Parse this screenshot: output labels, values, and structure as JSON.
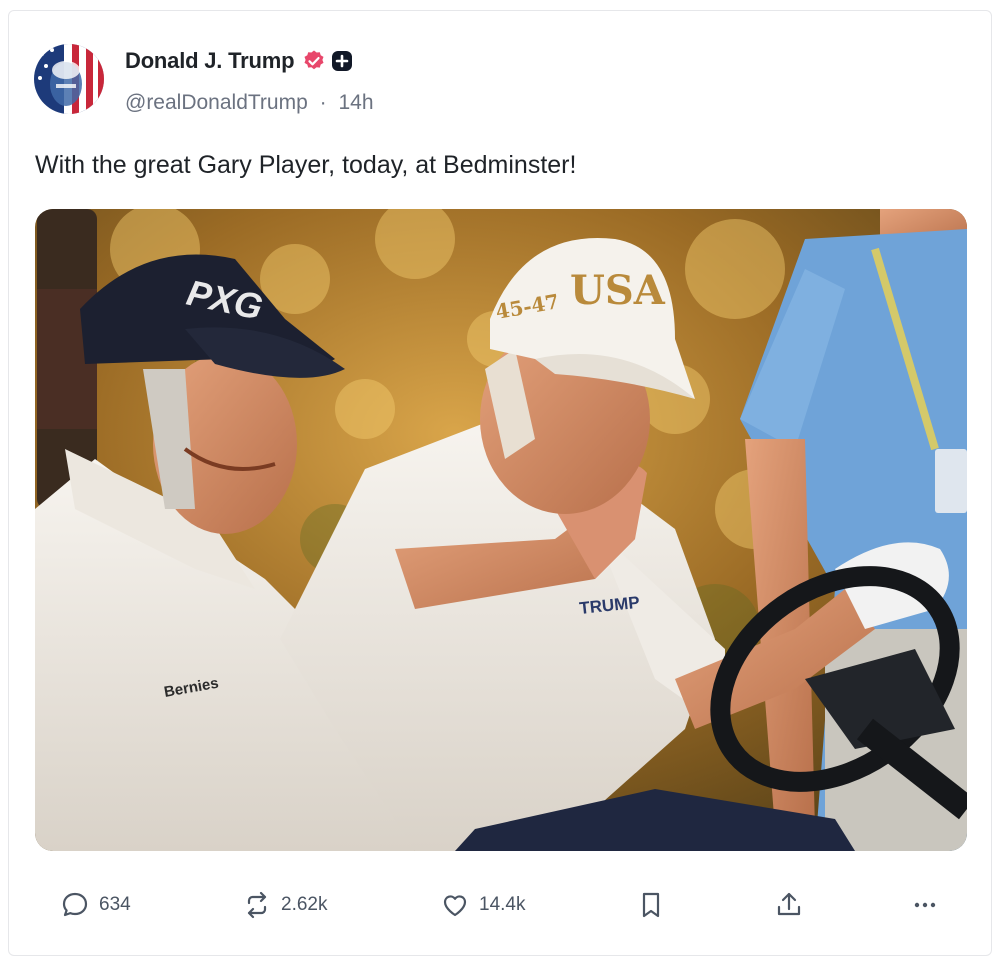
{
  "post": {
    "author": {
      "display_name": "Donald J. Trump",
      "handle": "@realDonaldTrump",
      "separator": "·",
      "time_ago": "14h",
      "avatar_icon": "flag-portrait-avatar",
      "verified_icon": "verified-check-icon",
      "verified_color": "#e8476b"
    },
    "text": "With the great Gary Player, today, at Bedminster!",
    "image": {
      "cap_left_text": "PXG",
      "cap_right_text": "USA",
      "cap_right_side_text": "45-47",
      "shirt_right_text": "TRUMP",
      "shirt_left_text": "Bernies"
    },
    "actions": {
      "replies": "634",
      "reposts": "2.62k",
      "likes": "14.4k",
      "bookmark_icon": "bookmark-icon",
      "share_icon": "share-icon",
      "more_icon": "more-icon"
    }
  },
  "colors": {
    "text": "#1f2328",
    "muted": "#6b7280",
    "border": "#e6e7ea"
  }
}
